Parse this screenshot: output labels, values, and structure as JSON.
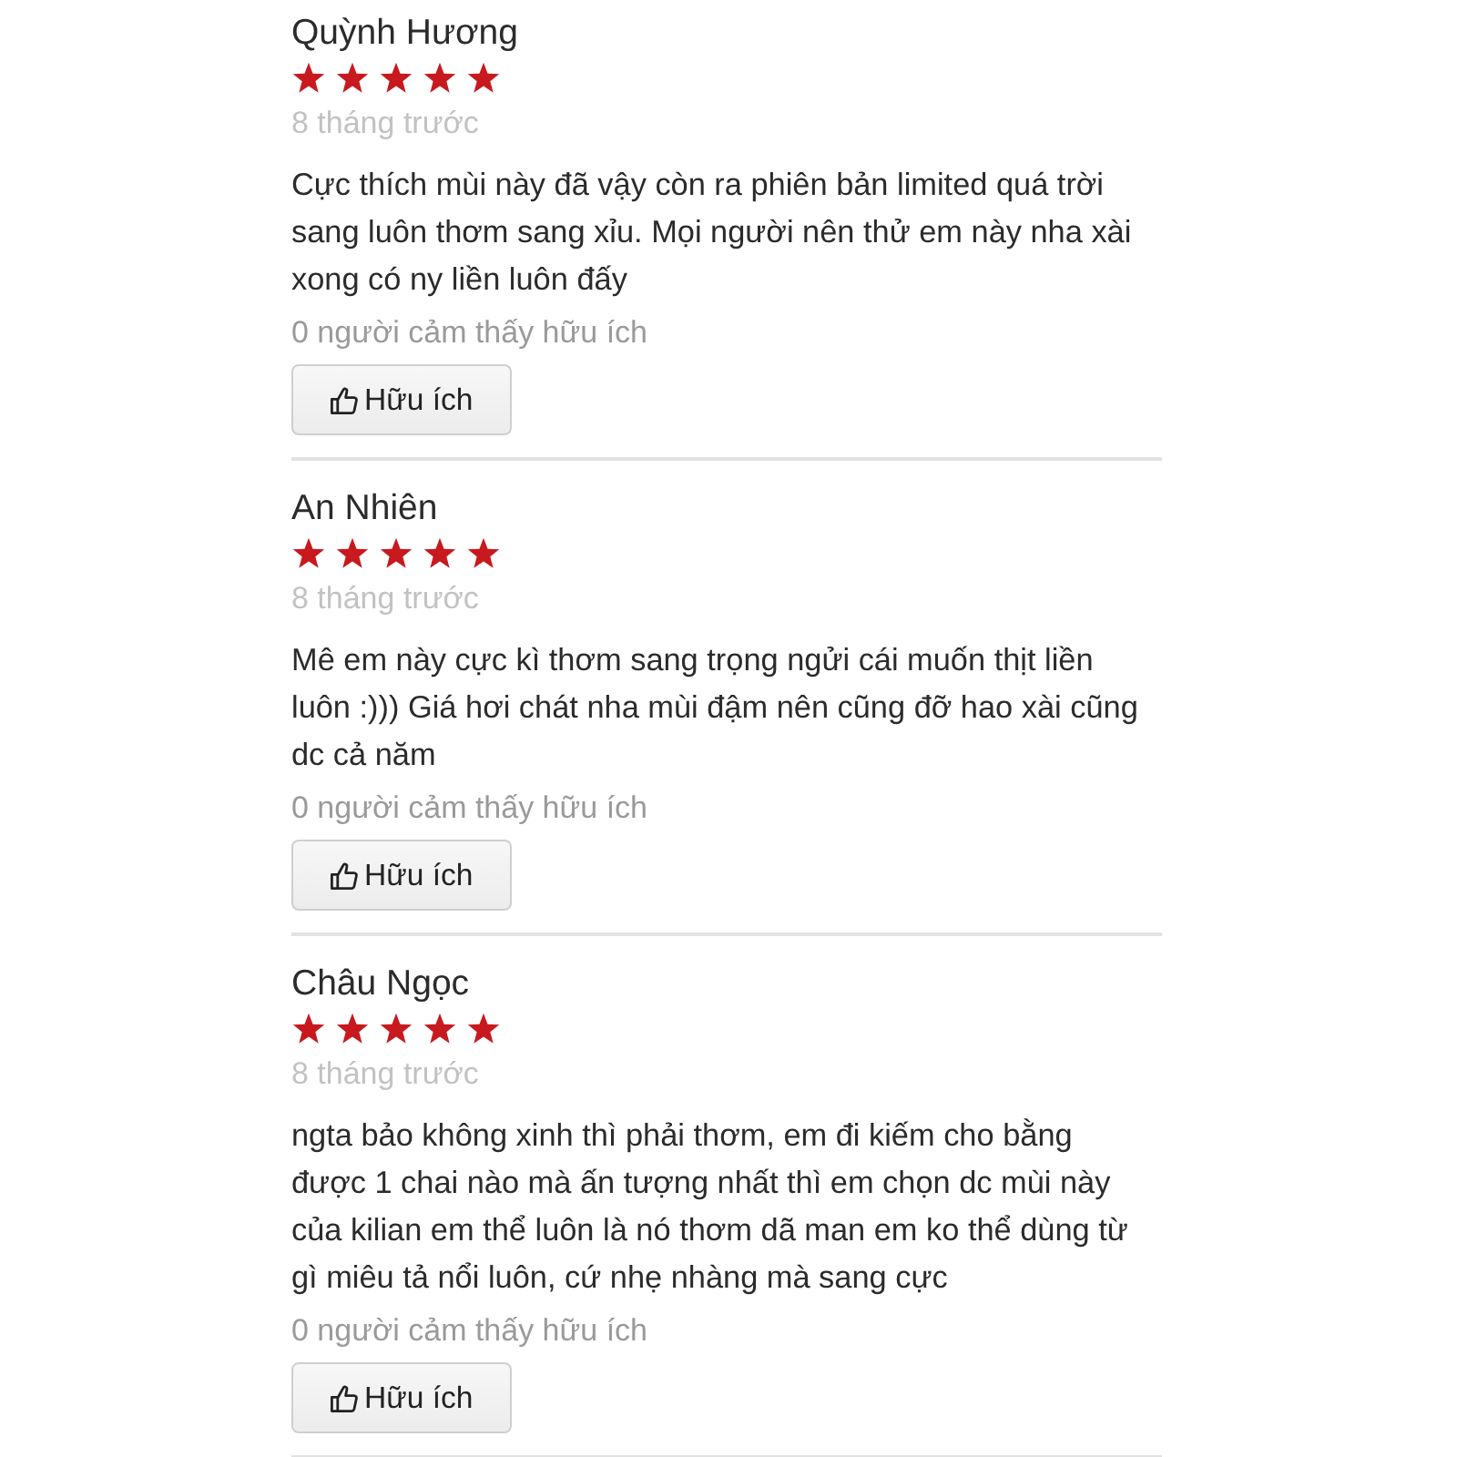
{
  "reviews": [
    {
      "author": "Quỳnh Hương",
      "stars": 5,
      "time": "8 tháng trước",
      "text": "Cực thích mùi này đã vậy còn ra phiên bản limited quá trời sang luôn thơm sang xỉu. Mọi người nên thử em này nha xài xong có ny liền luôn đấy",
      "helpful_count": "0 người cảm thấy hữu ích",
      "helpful_button": "Hữu ích"
    },
    {
      "author": "An Nhiên",
      "stars": 5,
      "time": "8 tháng trước",
      "text": "Mê em này cực kì thơm sang trọng ngửi cái muốn thịt liền luôn :))) Giá hơi chát nha mùi đậm nên cũng đỡ hao xài cũng dc cả năm",
      "helpful_count": "0 người cảm thấy hữu ích",
      "helpful_button": "Hữu ích"
    },
    {
      "author": "Châu Ngọc",
      "stars": 5,
      "time": "8 tháng trước",
      "text": "ngta bảo không xinh thì phải thơm, em đi kiếm cho bằng được 1 chai nào mà ấn tượng nhất thì em chọn dc mùi này của kilian em thể luôn là nó thơm dã man em ko thể dùng từ gì miêu tả nổi luôn, cứ nhẹ nhàng mà sang cực",
      "helpful_count": "0 người cảm thấy hữu ích",
      "helpful_button": "Hữu ích"
    }
  ]
}
